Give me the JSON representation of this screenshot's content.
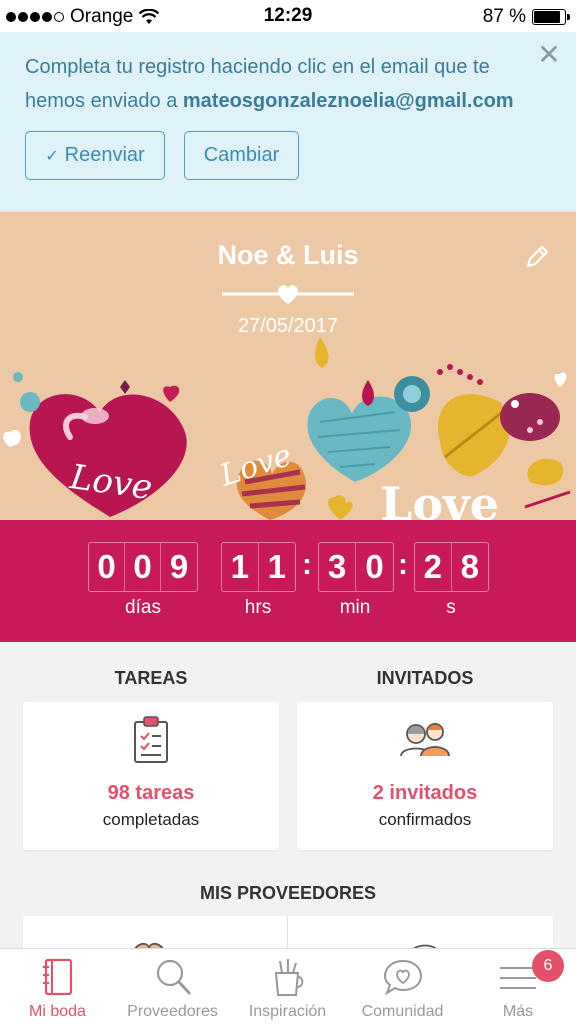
{
  "status_bar": {
    "carrier": "Orange",
    "time": "12:29",
    "battery": "87 %",
    "battery_level": 0.87
  },
  "banner": {
    "message": "Completa tu registro haciendo clic en el email que te hemos enviado a",
    "email": "mateosgonzaleznoelia@gmail.com",
    "resend_label": "Reenviar",
    "change_label": "Cambiar"
  },
  "hero": {
    "names": "Noe & Luis",
    "date": "27/05/2017",
    "background": "#ecc8a4"
  },
  "countdown": {
    "days_digits": [
      "0",
      "0",
      "9"
    ],
    "hours_digits": [
      "1",
      "1"
    ],
    "minutes_digits": [
      "3",
      "0"
    ],
    "seconds_digits": [
      "2",
      "8"
    ],
    "labels": {
      "days": "días",
      "hours": "hrs",
      "minutes": "min",
      "seconds": "s"
    },
    "color": "#c8195a"
  },
  "tasks": {
    "title": "TAREAS",
    "count": "98 tareas",
    "sub": "completadas",
    "icon": "clipboard-icon"
  },
  "guests": {
    "title": "INVITADOS",
    "count": "2 invitados",
    "sub": "confirmados",
    "icon": "couple-icon"
  },
  "vendors": {
    "title": "MIS PROVEEDORES"
  },
  "tabbar": {
    "items": [
      {
        "label": "Mi boda",
        "icon": "notebook-icon",
        "active": true
      },
      {
        "label": "Proveedores",
        "icon": "magnifier-icon",
        "active": false
      },
      {
        "label": "Inspiración",
        "icon": "cup-icon",
        "active": false
      },
      {
        "label": "Comunidad",
        "icon": "chat-heart-icon",
        "active": false
      },
      {
        "label": "Más",
        "icon": "menu-icon",
        "active": false
      }
    ],
    "badge": "6",
    "accent": "#e4506a"
  }
}
